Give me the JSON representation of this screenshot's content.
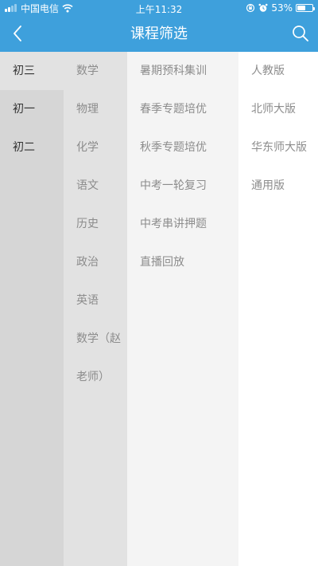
{
  "status_bar": {
    "carrier": "中国电信",
    "time": "上午11:32",
    "battery_percent": "53%",
    "battery_level": 0.53,
    "icons": [
      "signal-icon",
      "wifi-icon",
      "orientation-lock-icon",
      "alarm-icon",
      "battery-icon"
    ]
  },
  "nav": {
    "title": "课程筛选",
    "back_icon": "chevron-left-icon",
    "search_icon": "search-icon"
  },
  "colors": {
    "header": "#3ea0dc",
    "grade_bg": "#d6d6d6",
    "subject_bg": "#e2e2e2",
    "category_bg": "#f4f4f4",
    "edition_bg": "#ffffff"
  },
  "grades": [
    {
      "label": "初三",
      "selected": true
    },
    {
      "label": "初一",
      "selected": false
    },
    {
      "label": "初二",
      "selected": false
    }
  ],
  "subjects": [
    "数学",
    "物理",
    "化学",
    "语文",
    "历史",
    "政治",
    "英语",
    "数学（赵",
    "老师）"
  ],
  "categories": [
    "暑期预科集训",
    "春季专题培优",
    "秋季专题培优",
    "中考一轮复习",
    "中考串讲押题",
    "直播回放"
  ],
  "editions": [
    "人教版",
    "北师大版",
    "华东师大版",
    "通用版"
  ]
}
